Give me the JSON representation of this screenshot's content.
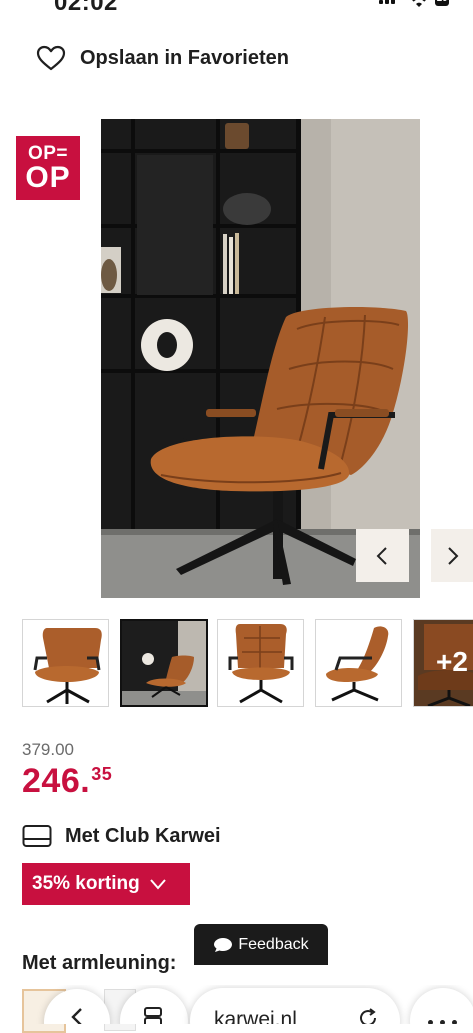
{
  "status_bar": {
    "time": "02:02",
    "battery": "10"
  },
  "favorites": {
    "label": "Opslaan in Favorieten"
  },
  "badge": {
    "line1": "OP=",
    "line2": "OP"
  },
  "gallery": {
    "more_label": "+2"
  },
  "price": {
    "old": "379.00",
    "new_main": "246.",
    "new_cents": "35"
  },
  "club": {
    "label": "Met Club Karwei"
  },
  "discount": {
    "label": "35% korting"
  },
  "options": {
    "armrest_label": "Met armleuning:"
  },
  "feedback": {
    "label": "Feedback"
  },
  "browser": {
    "url": "karwei.nl"
  },
  "colors": {
    "brand": "#c8103f",
    "leather": "#b0612c",
    "text": "#1f1f1f"
  },
  "icons": [
    "heart-icon",
    "card-icon",
    "chevron-down-icon",
    "chevron-left-icon",
    "chevron-right-icon",
    "chat-bubble-icon",
    "back-icon",
    "tabs-icon",
    "reload-icon",
    "more-icon"
  ]
}
